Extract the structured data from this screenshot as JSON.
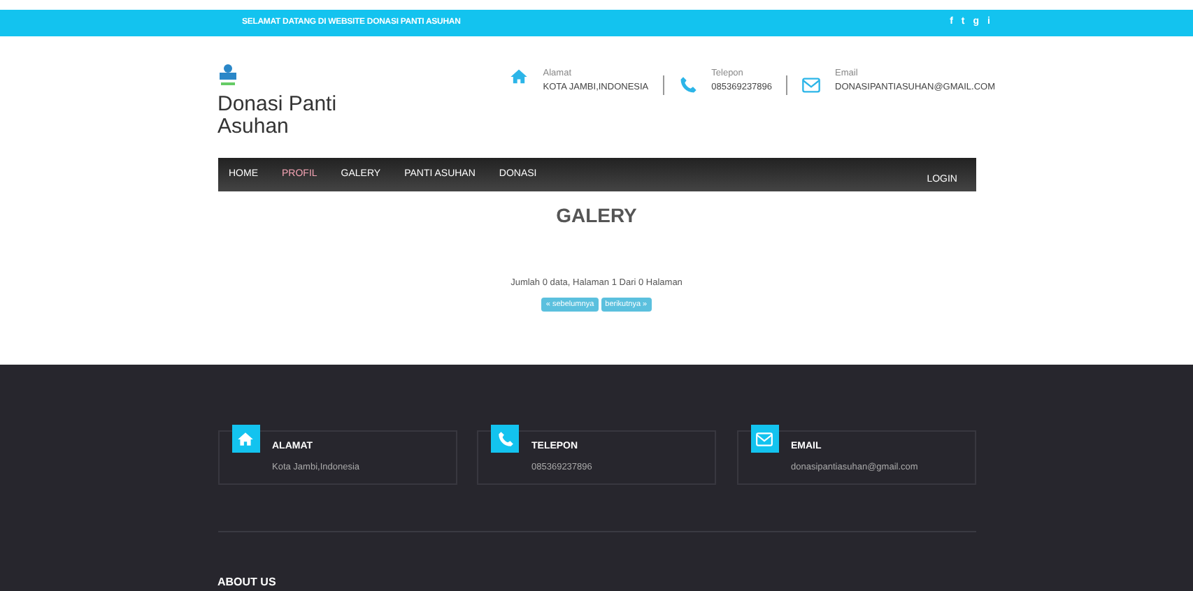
{
  "top_bar": {
    "welcome": "SELAMAT DATANG DI WEBSITE DONASI PANTI ASUHAN",
    "social": [
      "f",
      "t",
      "g",
      "i"
    ]
  },
  "header": {
    "site_title": "Donasi Panti Asuhan",
    "contacts": [
      {
        "kind": "home",
        "label": "Alamat",
        "value": "KOTA JAMBI,INDONESIA"
      },
      {
        "kind": "phone",
        "label": "Telepon",
        "value": "085369237896"
      },
      {
        "kind": "mail",
        "label": "Email",
        "value": "DONASIPANTIASUHAN@GMAIL.COM"
      }
    ]
  },
  "nav": {
    "items": [
      {
        "label": "HOME",
        "selected": false
      },
      {
        "label": "PROFIL",
        "selected": true
      },
      {
        "label": "GALERY",
        "selected": false
      },
      {
        "label": "PANTI ASUHAN",
        "selected": false
      },
      {
        "label": "DONASI",
        "selected": false
      }
    ],
    "login": "LOGIN"
  },
  "content": {
    "title": "GALERY",
    "summary": "Jumlah 0 data, Halaman 1 Dari 0 Halaman",
    "pager": [
      "« sebelumnya",
      "berikutnya »"
    ]
  },
  "footer": {
    "cards": [
      {
        "kind": "home",
        "title": "ALAMAT",
        "value": "Kota Jambi,Indonesia"
      },
      {
        "kind": "phone",
        "title": "TELEPON",
        "value": "085369237896"
      },
      {
        "kind": "mail",
        "title": "EMAIL",
        "value": "donasipantiasuhan@gmail.com"
      }
    ],
    "about_heading": "ABOUT US"
  }
}
